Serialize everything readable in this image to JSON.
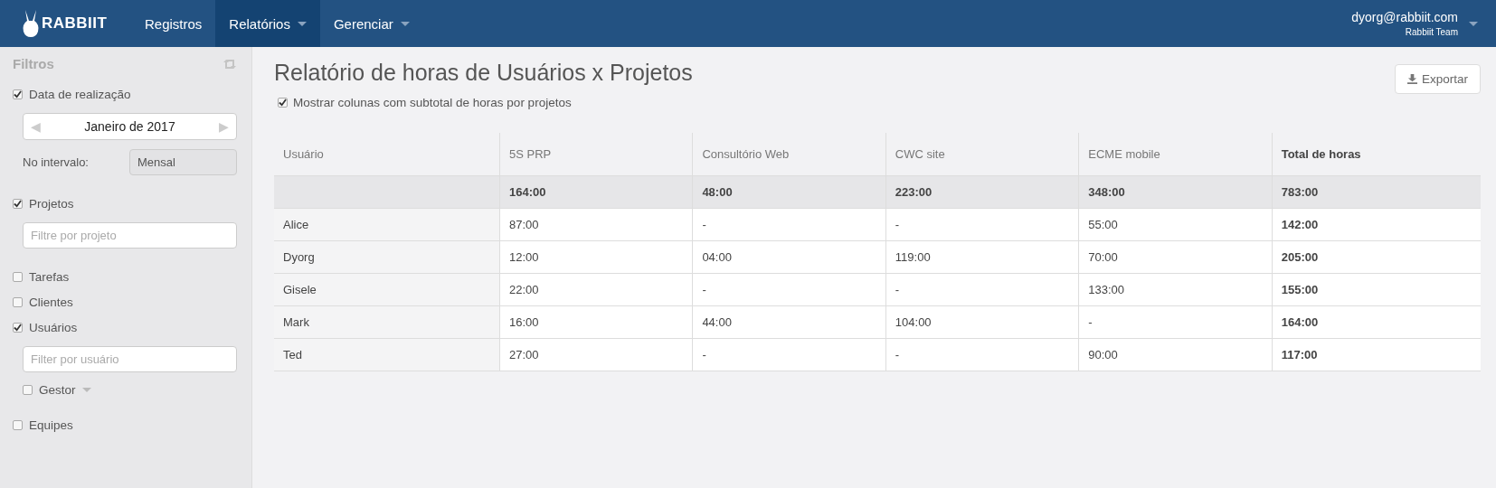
{
  "navbar": {
    "logo": "RABBIIT",
    "items": [
      {
        "label": "Registros",
        "selected": false,
        "dropdown": false
      },
      {
        "label": "Relatórios",
        "selected": true,
        "dropdown": true
      },
      {
        "label": "Gerenciar",
        "selected": false,
        "dropdown": true
      }
    ],
    "user": {
      "email": "dyorg@rabbiit.com",
      "team": "Rabbiit Team"
    }
  },
  "sidebar": {
    "title": "Filtros",
    "filters": [
      {
        "label": "Data de realização",
        "checked": true,
        "prev": "◀",
        "period": "Janeiro de 2017",
        "next": "▶",
        "interval_label": "No intervalo:",
        "interval": "Mensal"
      },
      {
        "label": "Projetos",
        "checked": true,
        "placeholder": "Filtre por projeto"
      },
      {
        "label": "Tarefas",
        "checked": false
      },
      {
        "label": "Clientes",
        "checked": false
      },
      {
        "label": "Usuários",
        "checked": true,
        "placeholder": "Filter por usuário",
        "sub": {
          "label": "Gestor",
          "checked": false
        }
      },
      {
        "label": "Equipes",
        "checked": false
      }
    ]
  },
  "main": {
    "title": "Relatório de horas de Usuários x Projetos",
    "option": {
      "label": "Mostrar colunas com subtotal de horas por projetos",
      "checked": true
    },
    "export_button": "Exportar",
    "table": {
      "columns": [
        "Usuário",
        "5S PRP",
        "Consultório Web",
        "CWC site",
        "ECME mobile",
        "Total de horas"
      ],
      "totals": [
        "164:00",
        "48:00",
        "223:00",
        "348:00",
        "783:00"
      ],
      "rows": [
        {
          "user": "Alice",
          "values": [
            "87:00",
            "-",
            "-",
            "55:00"
          ],
          "total": "142:00"
        },
        {
          "user": "Dyorg",
          "values": [
            "12:00",
            "04:00",
            "119:00",
            "70:00"
          ],
          "total": "205:00"
        },
        {
          "user": "Gisele",
          "values": [
            "22:00",
            "-",
            "-",
            "133:00"
          ],
          "total": "155:00"
        },
        {
          "user": "Mark",
          "values": [
            "16:00",
            "44:00",
            "104:00",
            "-"
          ],
          "total": "164:00"
        },
        {
          "user": "Ted",
          "values": [
            "27:00",
            "-",
            "-",
            "90:00"
          ],
          "total": "117:00"
        }
      ]
    }
  }
}
